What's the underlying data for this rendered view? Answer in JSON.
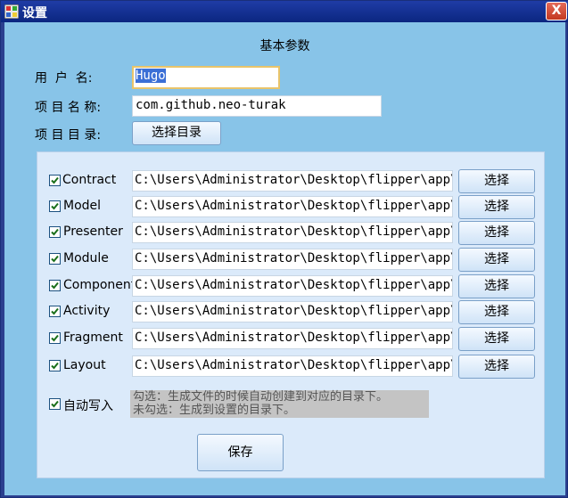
{
  "window": {
    "title": "设置",
    "close_label": "X"
  },
  "form": {
    "section_title": "基本参数",
    "username_label": "用  户  名:",
    "username_value": "Hugo",
    "project_name_label": "项 目 名 称:",
    "project_name_value": "com.github.neo-turak",
    "project_dir_label": "项 目 目 录:",
    "choose_dir_label": "选择目录"
  },
  "modules": [
    {
      "label": "Contract",
      "checked": true,
      "path": "C:\\Users\\Administrator\\Desktop\\flipper\\app\\s:",
      "button": "选择"
    },
    {
      "label": "Model",
      "checked": true,
      "path": "C:\\Users\\Administrator\\Desktop\\flipper\\app\\s:",
      "button": "选择"
    },
    {
      "label": "Presenter",
      "checked": true,
      "path": "C:\\Users\\Administrator\\Desktop\\flipper\\app\\s:",
      "button": "选择"
    },
    {
      "label": "Module",
      "checked": true,
      "path": "C:\\Users\\Administrator\\Desktop\\flipper\\app\\s:",
      "button": "选择"
    },
    {
      "label": "Component",
      "checked": true,
      "path": "C:\\Users\\Administrator\\Desktop\\flipper\\app\\s:",
      "button": "选择"
    },
    {
      "label": "Activity",
      "checked": true,
      "path": "C:\\Users\\Administrator\\Desktop\\flipper\\app\\s:",
      "button": "选择"
    },
    {
      "label": "Fragment",
      "checked": true,
      "path": "C:\\Users\\Administrator\\Desktop\\flipper\\app\\s:",
      "button": "选择"
    },
    {
      "label": "Layout",
      "checked": true,
      "path": "C:\\Users\\Administrator\\Desktop\\flipper\\app\\s:",
      "button": "选择"
    }
  ],
  "auto_write": {
    "label": "自动写入",
    "checked": true,
    "hint_line1": "勾选：生成文件的时候自动创建到对应的目录下。",
    "hint_line2": "未勾选：生成到设置的目录下。"
  },
  "save_label": "保存",
  "colors": {
    "titlebar": "#0b2680",
    "client": "#88c4e8",
    "group": "#dbeafa",
    "selection": "#3b6fd6"
  }
}
